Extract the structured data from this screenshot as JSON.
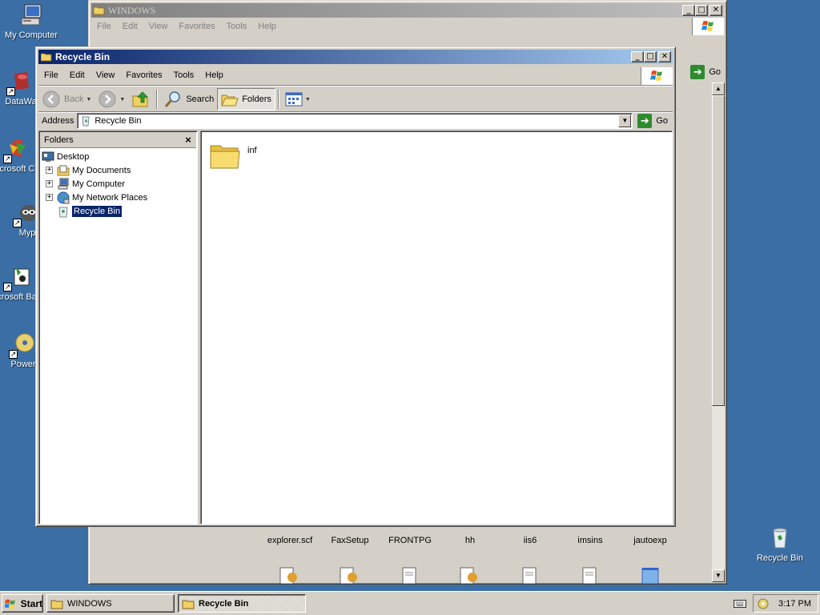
{
  "desktop": {
    "icons": [
      {
        "label": "My Computer"
      },
      {
        "label": "DataWa"
      },
      {
        "label": "Microsoft C++"
      },
      {
        "label": "Myp"
      },
      {
        "label": "Microsoft Basic"
      },
      {
        "label": "Power"
      },
      {
        "label": "Recycle Bin"
      }
    ]
  },
  "bg_window": {
    "title": "WINDOWS",
    "menu": [
      "File",
      "Edit",
      "View",
      "Favorites",
      "Tools",
      "Help"
    ],
    "go_label": "Go",
    "files_row1": [
      "explorer.scf",
      "FaxSetup",
      "FRONTPG",
      "hh",
      "iis6",
      "imsins",
      "jautoexp"
    ]
  },
  "fg_window": {
    "title": "Recycle Bin",
    "menu": [
      "File",
      "Edit",
      "View",
      "Favorites",
      "Tools",
      "Help"
    ],
    "toolbar": {
      "back": "Back",
      "search": "Search",
      "folders": "Folders"
    },
    "address": {
      "label": "Address",
      "value": "Recycle Bin",
      "go": "Go"
    },
    "folders_pane": {
      "title": "Folders",
      "tree": [
        "Desktop",
        "My Documents",
        "My Computer",
        "My Network Places",
        "Recycle Bin"
      ]
    },
    "content": {
      "items": [
        {
          "name": "inf"
        }
      ]
    }
  },
  "taskbar": {
    "start": "Start",
    "tasks": [
      "WINDOWS",
      "Recycle Bin"
    ],
    "clock": "3:17 PM"
  },
  "colors": {
    "desktop": "#3a6ea5",
    "title_active": "#0a246a",
    "title_inactive": "#808080",
    "face": "#d4d0c8"
  }
}
